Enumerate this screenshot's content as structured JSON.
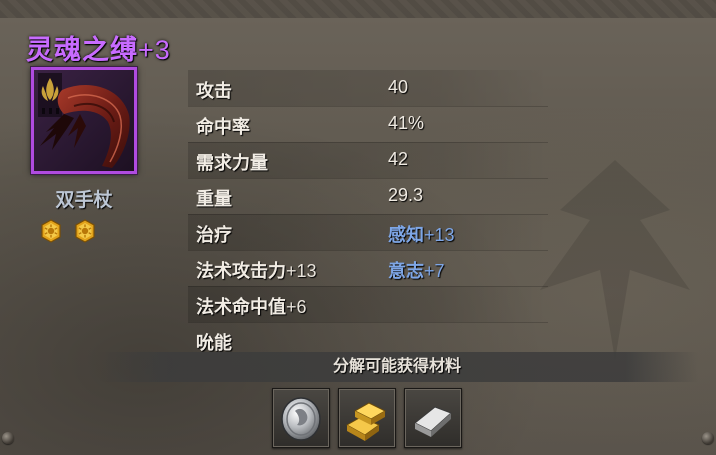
{
  "item": {
    "name": "灵魂之缚",
    "enhance": "+3",
    "weapon_type": "双手杖",
    "rarity_color": "#c86bff"
  },
  "gems": [
    {
      "icon": "gold-sun-gem-icon"
    },
    {
      "icon": "gold-sun-gem-icon"
    }
  ],
  "stats": [
    {
      "label": "攻击",
      "value": "40"
    },
    {
      "label": "命中率",
      "value": "41%"
    },
    {
      "label": "需求力量",
      "value": "42"
    },
    {
      "label": "重量",
      "value": "29.3"
    },
    {
      "label": "治疗",
      "value_attr": "感知",
      "value_bonus": "+13"
    },
    {
      "label": "法术攻击力",
      "label_bonus": "+13",
      "value_attr": "意志",
      "value_bonus": "+7"
    },
    {
      "label": "法术命中值",
      "label_bonus": "+6"
    },
    {
      "label": "吮能"
    }
  ],
  "materials": {
    "header": "分解可能获得材料",
    "items": [
      {
        "icon": "silver-coin-icon"
      },
      {
        "icon": "gold-bars-icon"
      },
      {
        "icon": "iron-ingot-icon"
      }
    ]
  }
}
